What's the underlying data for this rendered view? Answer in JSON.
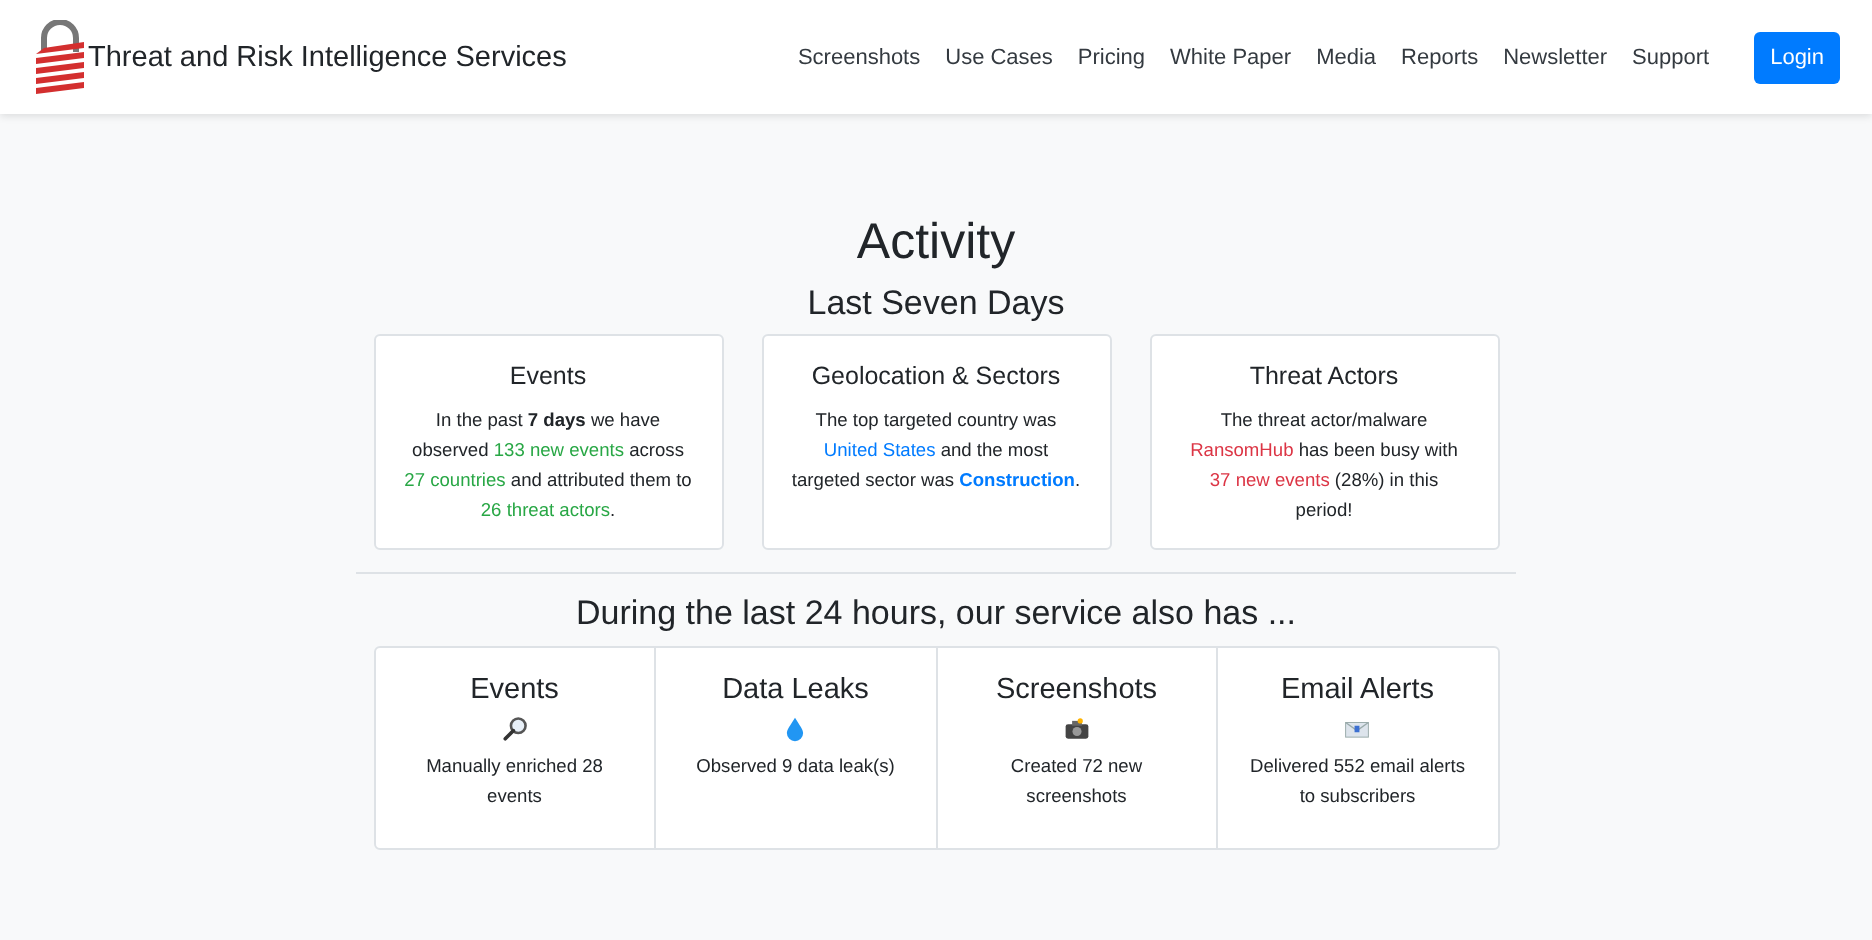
{
  "navbar": {
    "brand": "Threat and Risk Intelligence Services",
    "links": [
      "Screenshots",
      "Use Cases",
      "Pricing",
      "White Paper",
      "Media",
      "Reports",
      "Newsletter",
      "Support"
    ],
    "login": "Login"
  },
  "title": "Activity",
  "subtitle": "Last Seven Days",
  "weekly_cards": [
    {
      "title": "Events",
      "text": [
        {
          "text": "In the past "
        },
        {
          "text": "7 days",
          "bold": true
        },
        {
          "text": " we have observed "
        },
        {
          "text": "133 new events",
          "color": "#28a745"
        },
        {
          "text": " across "
        },
        {
          "text": "27 countries",
          "color": "#28a745"
        },
        {
          "text": " and attributed them to "
        },
        {
          "text": "26 threat actors",
          "color": "#28a745"
        },
        {
          "text": "."
        }
      ]
    },
    {
      "title": "Geolocation & Sectors",
      "text": [
        {
          "text": "The top targeted country was "
        },
        {
          "text": "United States",
          "color": "#007bff"
        },
        {
          "text": " and the most targeted sector was "
        },
        {
          "text": "Construction",
          "color": "#007bff",
          "bold": true
        },
        {
          "text": "."
        }
      ]
    },
    {
      "title": "Threat Actors",
      "text": [
        {
          "text": "The threat actor/malware "
        },
        {
          "text": "RansomHub",
          "color": "#dc3545"
        },
        {
          "text": " has been busy with "
        },
        {
          "text": "37 new events",
          "color": "#dc3545"
        },
        {
          "text": " (28%) in this period!"
        }
      ]
    }
  ],
  "daily_heading": "During the last 24 hours, our service also has ...",
  "daily_cards": [
    {
      "title": "Events",
      "kind": "magnifier",
      "text": "Manually enriched 28 events"
    },
    {
      "title": "Data Leaks",
      "kind": "droplet",
      "text": "Observed 9 data leak(s)"
    },
    {
      "title": "Screenshots",
      "kind": "camera",
      "text": "Created 72 new screenshots"
    },
    {
      "title": "Email Alerts",
      "kind": "envelope",
      "text": "Delivered 552 email alerts to subscribers"
    }
  ]
}
